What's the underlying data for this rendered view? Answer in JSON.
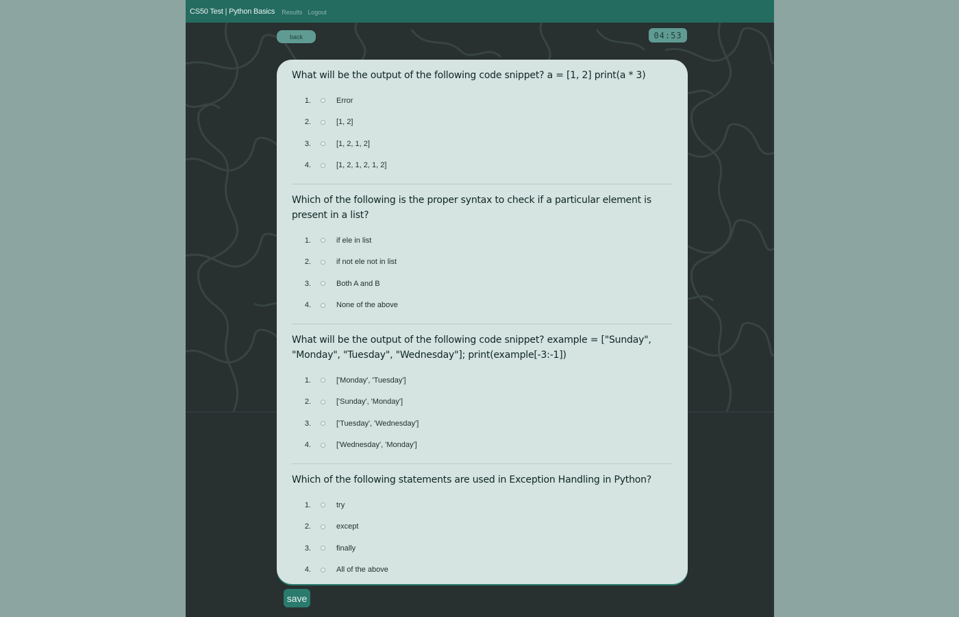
{
  "nav": {
    "brand": "CS50 Test | Python Basics",
    "links": [
      "Results",
      "Logout"
    ]
  },
  "back_label": "back",
  "timer": "04:53",
  "save_label": "save",
  "questions": [
    {
      "text": "What will be the output of the following code snippet? a = [1, 2] print(a * 3)",
      "options": [
        "Error",
        "[1, 2]",
        "[1, 2, 1, 2]",
        "[1, 2, 1, 2, 1, 2]"
      ]
    },
    {
      "text": "Which of the following is the proper syntax to check if a particular element is present in a list?",
      "options": [
        "if ele in list",
        "if not ele not in list",
        "Both A and B",
        "None of the above"
      ]
    },
    {
      "text": "What will be the output of the following code snippet? example = [\"Sunday\", \"Monday\", \"Tuesday\", \"Wednesday\"]; print(example[-3:-1])",
      "options": [
        "['Monday', 'Tuesday']",
        "['Sunday', 'Monday']",
        "['Tuesday', 'Wednesday']",
        "['Wednesday', 'Monday']"
      ]
    },
    {
      "text": "Which of the following statements are used in Exception Handling in Python?",
      "options": [
        "try",
        "except",
        "finally",
        "All of the above"
      ]
    }
  ],
  "colors": {
    "page_bg": "#8da5a0",
    "app_bg": "#283030",
    "navbar": "#246b60",
    "accent": "#5f9b92",
    "card": "#d5e3e1",
    "save_button": "#2a7a6e"
  }
}
